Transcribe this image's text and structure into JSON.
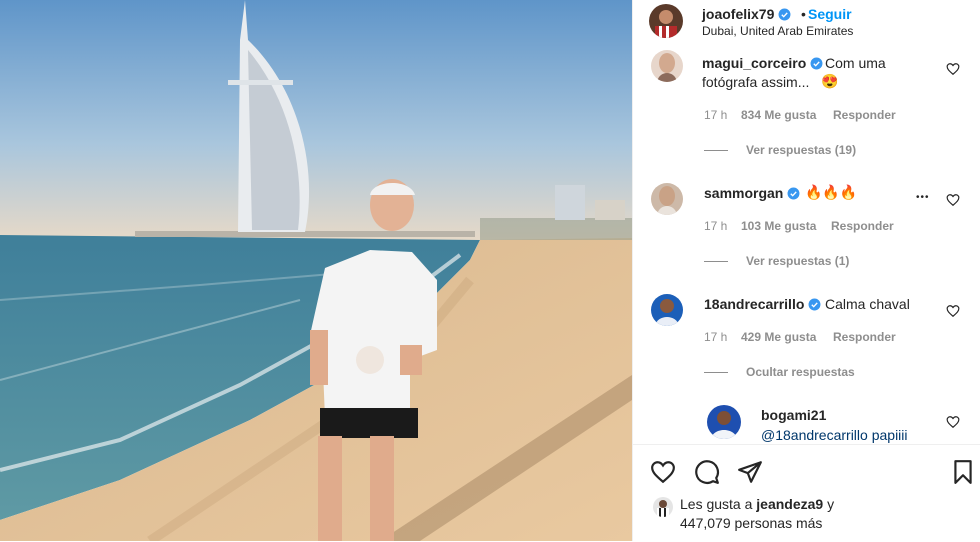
{
  "post": {
    "username": "joaofelix79",
    "separator": "•",
    "follow_label": "Seguir",
    "location": "Dubai, United Arab Emirates"
  },
  "comments": [
    {
      "username": "magui_corceiro",
      "verified": true,
      "text_line1": "Com uma",
      "text_line2": "fotógrafa assim...",
      "emoji": "😍",
      "time": "17 h",
      "likes": "834 Me gusta",
      "reply": "Responder",
      "replies_toggle": "Ver respuestas (19)"
    },
    {
      "username": "sammorgan",
      "verified": true,
      "text": "🔥🔥🔥",
      "time": "17 h",
      "likes": "103 Me gusta",
      "reply": "Responder",
      "options": "•••",
      "replies_toggle": "Ver respuestas (1)"
    },
    {
      "username": "18andrecarrillo",
      "verified": true,
      "text": "Calma chaval",
      "time": "17 h",
      "likes": "429 Me gusta",
      "reply": "Responder",
      "replies_toggle": "Ocultar respuestas"
    },
    {
      "username": "bogami21",
      "verified": false,
      "text": "@18andrecarrillo papiiii"
    }
  ],
  "actions": {
    "likes_prefix": "Les gusta a",
    "likes_user": "jeandeza9",
    "likes_suffix": "y",
    "likes_count": "447,079 personas más"
  },
  "colors": {
    "accent": "#0095f6",
    "verified": "#3897f0",
    "muted": "#8e8e8e",
    "text": "#262626"
  },
  "icons": [
    "heart-icon",
    "comment-icon",
    "share-icon",
    "bookmark-icon",
    "verified-icon",
    "more-options-icon"
  ]
}
